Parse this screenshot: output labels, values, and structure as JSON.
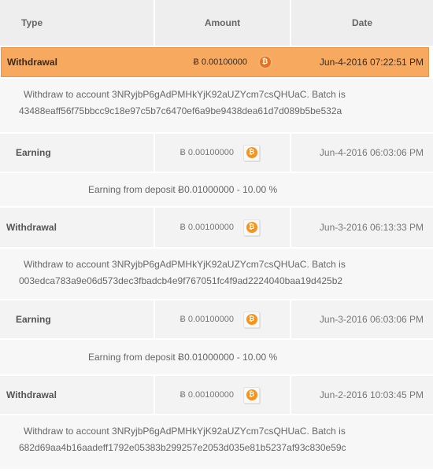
{
  "header": {
    "type": "Type",
    "amount": "Amount",
    "date": "Date"
  },
  "rows": [
    {
      "type": "Withdrawal",
      "amount": "Ƀ 0.00100000",
      "coin": "bitcoin-icon",
      "date": "Jun-4-2016 07:22:51 PM",
      "detail_line1": "Withdraw to account 3NRyjbP6gAdPMHkYjK92aUZYcm7csQHUaC. Batch is",
      "detail_line2": "43488eaff56f75bbcc9c18e97c5b7c6470ef6a9be9438dea61d7d089b5be532a"
    },
    {
      "type": "Earning",
      "amount": "Ƀ 0.00100000",
      "coin": "bitcoin-icon",
      "date": "Jun-4-2016 06:03:06 PM",
      "detail_line1": "Earning from deposit Ƀ0.01000000 - 10.00 %"
    },
    {
      "type": "Withdrawal",
      "amount": "Ƀ 0.00100000",
      "coin": "bitcoin-icon",
      "date": "Jun-3-2016 06:13:33 PM",
      "detail_line1": "Withdraw to account 3NRyjbP6gAdPMHkYjK92aUZYcm7csQHUaC. Batch is",
      "detail_line2": "003edca783a9e06d573dec3fbadcb4e9f767051fc4f9ad2224040baa19d425b2"
    },
    {
      "type": "Earning",
      "amount": "Ƀ 0.00100000",
      "coin": "bitcoin-icon",
      "date": "Jun-3-2016 06:03:06 PM",
      "detail_line1": "Earning from deposit Ƀ0.01000000 - 10.00 %"
    },
    {
      "type": "Withdrawal",
      "amount": "Ƀ 0.00100000",
      "coin": "bitcoin-icon",
      "date": "Jun-2-2016 10:03:45 PM",
      "detail_line1": "Withdraw to account 3NRyjbP6gAdPMHkYjK92aUZYcm7csQHUaC. Batch is",
      "detail_line2": "682d69aa4b16aadeff1792e05383b299257e2053d035e81b5237af93c830e59c"
    }
  ],
  "colors": {
    "selected_row": "#f6a95f",
    "bitcoin": "#f7931a",
    "header_bg": "#eeeeee"
  },
  "coin_glyph": "₿"
}
